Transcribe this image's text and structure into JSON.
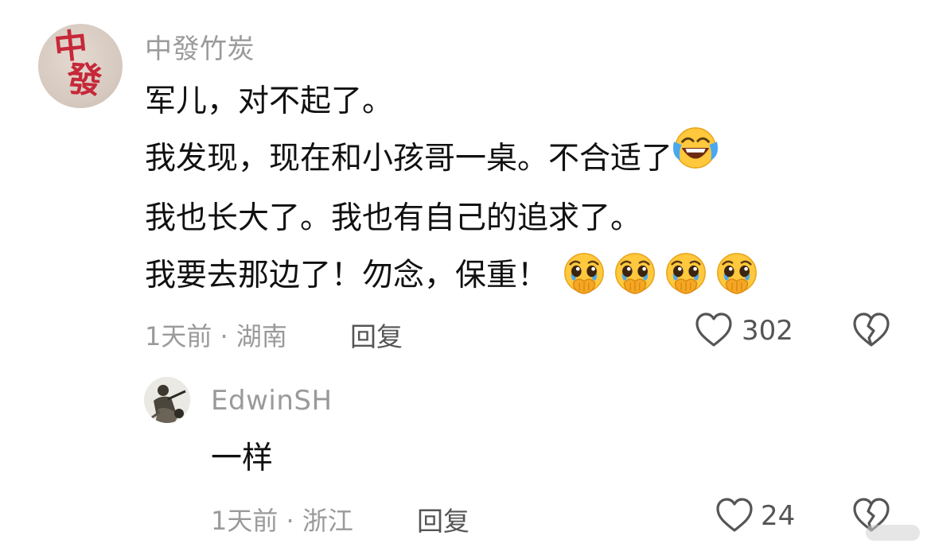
{
  "comment": {
    "username": "中發竹炭",
    "avatar_text": [
      "中",
      "發"
    ],
    "lines": [
      "军儿，对不起了。",
      "我发现，现在和小孩哥一桌。不合适了",
      "我也长大了。我也有自己的追求了。",
      "我要去那边了！勿念，保重！"
    ],
    "line2_emoji": "rolling-on-floor-laughing",
    "line4_emoji": [
      "holding-back-tears",
      "holding-back-tears",
      "holding-back-tears",
      "holding-back-tears"
    ],
    "time_location": "1天前 · 湖南",
    "reply_label": "回复",
    "like_count": "302",
    "like_icon": "heart-outline-icon",
    "dislike_icon": "broken-heart-icon"
  },
  "reply": {
    "username": "EdwinSH",
    "text": "一样",
    "time_location": "1天前 · 浙江",
    "reply_label": "回复",
    "like_count": "24",
    "like_icon": "heart-outline-icon",
    "dislike_icon": "broken-heart-icon"
  }
}
